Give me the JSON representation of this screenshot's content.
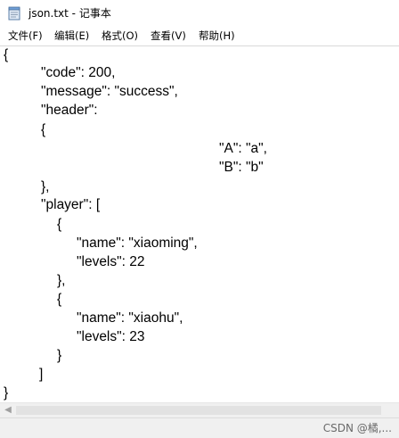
{
  "window": {
    "title": "json.txt - 记事本",
    "icon": "notepad-icon"
  },
  "menu": [
    {
      "label": "文件(F)"
    },
    {
      "label": "编辑(E)"
    },
    {
      "label": "格式(O)"
    },
    {
      "label": "查看(V)"
    },
    {
      "label": "帮助(H)"
    }
  ],
  "content": {
    "lines": [
      "{",
      "\"code\": 200,",
      "\"message\": \"success\",",
      "\"header\":",
      "{",
      "\"A\": \"a\",",
      "\"B\": \"b\"",
      "},",
      "\"player\": [",
      "{",
      "\"name\": \"xiaoming\",",
      "\"levels\": 22",
      "},",
      "{",
      "\"name\": \"xiaohu\",",
      "\"levels\": 23",
      "}",
      "]",
      "}"
    ]
  },
  "statusbar": {
    "watermark": "CSDN @橘,..."
  }
}
